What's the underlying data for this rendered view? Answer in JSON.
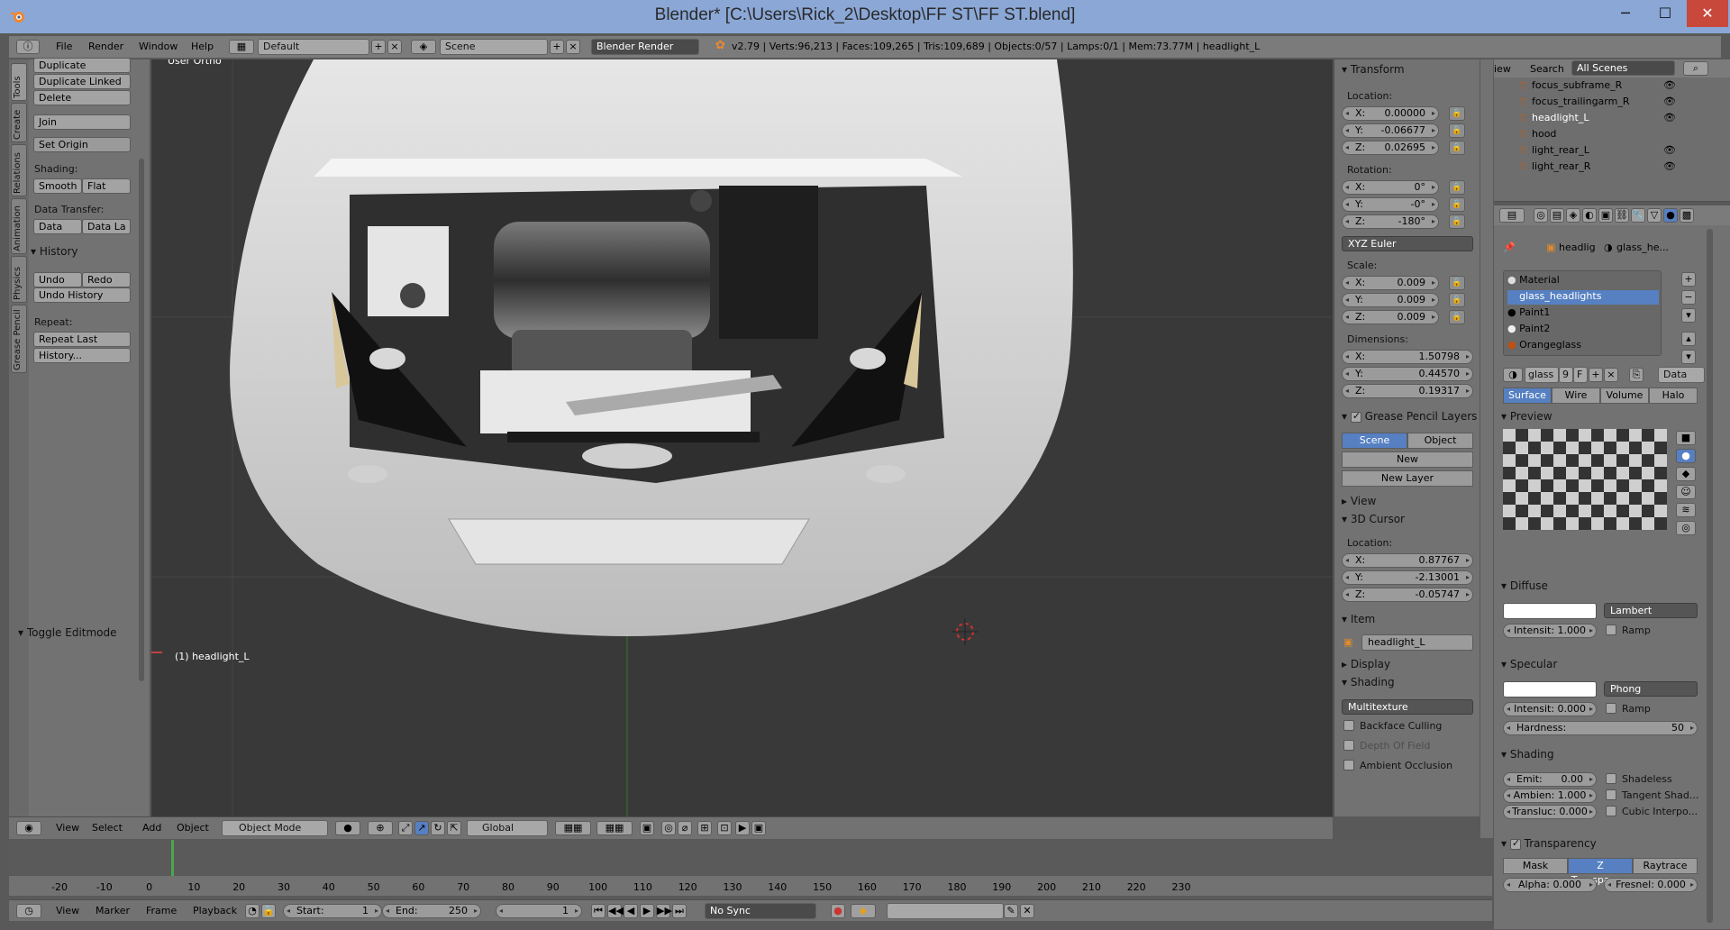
{
  "window": {
    "title": "Blender* [C:\\Users\\Rick_2\\Desktop\\FF ST\\FF ST.blend]",
    "minimize": "─",
    "maximize": "☐",
    "close": "✕"
  },
  "info_header": {
    "menus": [
      "File",
      "Render",
      "Window",
      "Help"
    ],
    "layout": "Default",
    "scene": "Scene",
    "engine": "Blender Render",
    "stats": "v2.79 | Verts:96,213 | Faces:109,265 | Tris:109,689 | Objects:0/57 | Lamps:0/1 | Mem:73.77M | headlight_L"
  },
  "tool_tabs": [
    "Tools",
    "Create",
    "Relations",
    "Animation",
    "Physics",
    "Grease Pencil"
  ],
  "tool_shelf": {
    "duplicate": "Duplicate",
    "duplicate_linked": "Duplicate Linked",
    "delete": "Delete",
    "join": "Join",
    "set_origin": "Set Origin",
    "shading_label": "Shading:",
    "smooth": "Smooth",
    "flat": "Flat",
    "data_transfer_label": "Data Transfer:",
    "data": "Data",
    "data_la": "Data La",
    "history_header": "History",
    "undo": "Undo",
    "redo": "Redo",
    "undo_history": "Undo History",
    "repeat_label": "Repeat:",
    "repeat_last": "Repeat Last",
    "history_dots": "History...",
    "toggle_editmode": "Toggle Editmode"
  },
  "viewport": {
    "view_label": "User Ortho",
    "object_label": "(1) headlight_L"
  },
  "viewport_header": {
    "menus": [
      "View",
      "Select",
      "Add",
      "Object"
    ],
    "mode": "Object Mode",
    "orientation": "Global"
  },
  "n_panel": {
    "transform_header": "Transform",
    "location_label": "Location:",
    "location": [
      {
        "k": "X:",
        "v": "0.00000"
      },
      {
        "k": "Y:",
        "v": "-0.06677"
      },
      {
        "k": "Z:",
        "v": "0.02695"
      }
    ],
    "rotation_label": "Rotation:",
    "rotation": [
      {
        "k": "X:",
        "v": "0°"
      },
      {
        "k": "Y:",
        "v": "-0°"
      },
      {
        "k": "Z:",
        "v": "-180°"
      }
    ],
    "rotation_mode": "XYZ Euler",
    "scale_label": "Scale:",
    "scale": [
      {
        "k": "X:",
        "v": "0.009"
      },
      {
        "k": "Y:",
        "v": "0.009"
      },
      {
        "k": "Z:",
        "v": "0.009"
      }
    ],
    "dimensions_label": "Dimensions:",
    "dimensions": [
      {
        "k": "X:",
        "v": "1.50798"
      },
      {
        "k": "Y:",
        "v": "0.44570"
      },
      {
        "k": "Z:",
        "v": "0.19317"
      }
    ],
    "gp_header": "Grease Pencil Layers",
    "gp_scene": "Scene",
    "gp_object": "Object",
    "gp_new": "New",
    "gp_new_layer": "New Layer",
    "view_header": "View",
    "cursor_header": "3D Cursor",
    "cursor_location_label": "Location:",
    "cursor": [
      {
        "k": "X:",
        "v": "0.87767"
      },
      {
        "k": "Y:",
        "v": "-2.13001"
      },
      {
        "k": "Z:",
        "v": "-0.05747"
      }
    ],
    "item_header": "Item",
    "item_name": "headlight_L",
    "display_header": "Display",
    "shading_header": "Shading",
    "shading_mode": "Multitexture",
    "backface": "Backface Culling",
    "dof": "Depth Of Field",
    "ao": "Ambient Occlusion"
  },
  "outliner": {
    "view": "iew",
    "search": "Search",
    "scenes": "All Scenes",
    "rows": [
      "focus_subframe_R",
      "focus_trailingarm_R",
      "headlight_L",
      "hood",
      "light_rear_L",
      "light_rear_R"
    ]
  },
  "properties": {
    "breadcrumb_obj": "headlig",
    "breadcrumb_mat": "glass_he...",
    "materials": [
      "Material",
      "glass_headlights",
      "Paint1",
      "Paint2",
      "Orangeglass"
    ],
    "mat_field": "glass",
    "mat_users": "9",
    "mat_fake": "F",
    "mat_data": "Data",
    "tabs": [
      "Surface",
      "Wire",
      "Volume",
      "Halo"
    ],
    "preview_header": "Preview",
    "diffuse_header": "Diffuse",
    "diffuse_shader": "Lambert",
    "diffuse_intensity": "Intensit: 1.000",
    "ramp": "Ramp",
    "specular_header": "Specular",
    "specular_shader": "Phong",
    "specular_intensity": "Intensit: 0.000",
    "hardness_label": "Hardness:",
    "hardness": "50",
    "shading_header": "Shading",
    "emit": "Emit:",
    "emit_v": "0.00",
    "ambient": "Ambien: 1.000",
    "transluc": "Transluc: 0.000",
    "shadeless": "Shadeless",
    "tangent": "Tangent Shad...",
    "cubic": "Cubic Interpo...",
    "transparency_header": "Transparency",
    "mask": "Mask",
    "ztransp": "Z Transpare...",
    "raytrace": "Raytrace",
    "alpha": "Alpha: 0.000",
    "fresnel": "Fresnel: 0.000"
  },
  "timeline": {
    "ticks": [
      "-20",
      "-10",
      "0",
      "10",
      "20",
      "30",
      "40",
      "50",
      "60",
      "70",
      "80",
      "90",
      "100",
      "110",
      "120",
      "130",
      "140",
      "150",
      "160",
      "170",
      "180",
      "190",
      "200",
      "210",
      "220",
      "230"
    ],
    "menus": [
      "View",
      "Marker",
      "Frame",
      "Playback"
    ],
    "start": "Start:",
    "start_v": "1",
    "end": "End:",
    "end_v": "250",
    "current": "1",
    "sync": "No Sync"
  },
  "colors": {
    "accent": "#5680c2",
    "headlight": "#d8c79a",
    "titlebar": "#8aa7d6"
  }
}
